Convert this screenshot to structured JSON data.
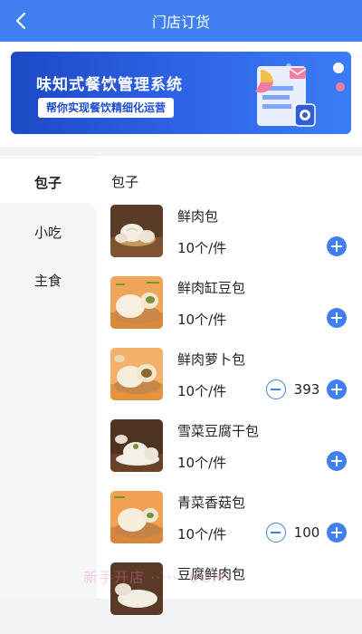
{
  "header": {
    "title": "门店订货"
  },
  "banner": {
    "title": "味知式餐饮管理系统",
    "subtitle": "帮你实现餐饮精细化运营",
    "colors": {
      "background": "#2f66e8",
      "accent": "#f3be47",
      "pink": "#f07e9f"
    }
  },
  "sidebar": {
    "items": [
      {
        "label": "包子",
        "active": true
      },
      {
        "label": "小吃"
      },
      {
        "label": "主食"
      }
    ]
  },
  "category_title": "包子",
  "products": [
    {
      "name": "鲜肉包",
      "spec": "10个/件",
      "quantity": ""
    },
    {
      "name": "鲜肉缸豆包",
      "spec": "10个/件",
      "quantity": ""
    },
    {
      "name": "鲜肉萝卜包",
      "spec": "10个/件",
      "quantity": "393"
    },
    {
      "name": "雪菜豆腐干包",
      "spec": "10个/件",
      "quantity": ""
    },
    {
      "name": "青菜香菇包",
      "spec": "10个/件",
      "quantity": "100"
    },
    {
      "name": "豆腐鲜肉包",
      "spec": "",
      "quantity": ""
    }
  ],
  "icons": {
    "back": "chevron-left-icon",
    "add": "plus-circle-icon",
    "remove": "minus-circle-icon"
  },
  "watermark": "新手开店 ·······COM",
  "colors": {
    "primary": "#3f7ff0",
    "sidebar_bg": "#f5f6f8"
  }
}
